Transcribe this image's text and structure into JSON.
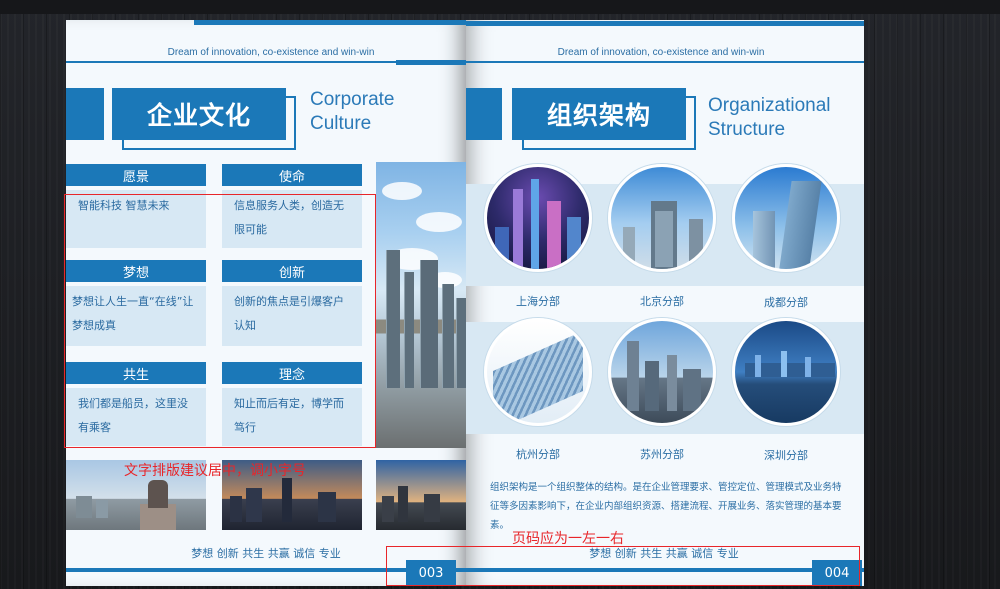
{
  "tagline": "Dream of innovation, co-existence and win-win",
  "left_page": {
    "title_cn": "企业文化",
    "title_en_line1": "Corporate",
    "title_en_line2": "Culture",
    "cards": [
      {
        "head": "愿景",
        "body": "智能科技 智慧未来"
      },
      {
        "head": "使命",
        "body": "信息服务人类，创造无限可能"
      },
      {
        "head": "梦想",
        "body": "梦想让人生一直“在线”让梦想成真"
      },
      {
        "head": "创新",
        "body": "创新的焦点是引爆客户认知"
      },
      {
        "head": "共生",
        "body": "我们都是船员，这里没有乘客"
      },
      {
        "head": "理念",
        "body": "知止而后有定，博学而笃行"
      }
    ],
    "footer": "梦想 创新 共生 共赢 诚信 专业",
    "page_number": "003"
  },
  "right_page": {
    "title_cn": "组织架构",
    "title_en_line1": "Organizational",
    "title_en_line2": "Structure",
    "branches": [
      "上海分部",
      "北京分部",
      "成都分部",
      "杭州分部",
      "苏州分部",
      "深圳分部"
    ],
    "description": "组织架构是一个组织整体的结构。是在企业管理要求、管控定位、管理模式及业务特征等多因素影响下，在企业内部组织资源、搭建流程、开展业务、落实管理的基本要素。",
    "footer": "梦想 创新 共生 共赢 诚信 专业",
    "page_number": "004"
  },
  "annotations": {
    "left_note": "文字排版建议居中，调小字号",
    "right_note": "页码应为一左一右"
  },
  "colors": {
    "brand_blue": "#1b78b8",
    "card_bg": "#d7e8f4",
    "annotation_red": "#e8262a"
  }
}
